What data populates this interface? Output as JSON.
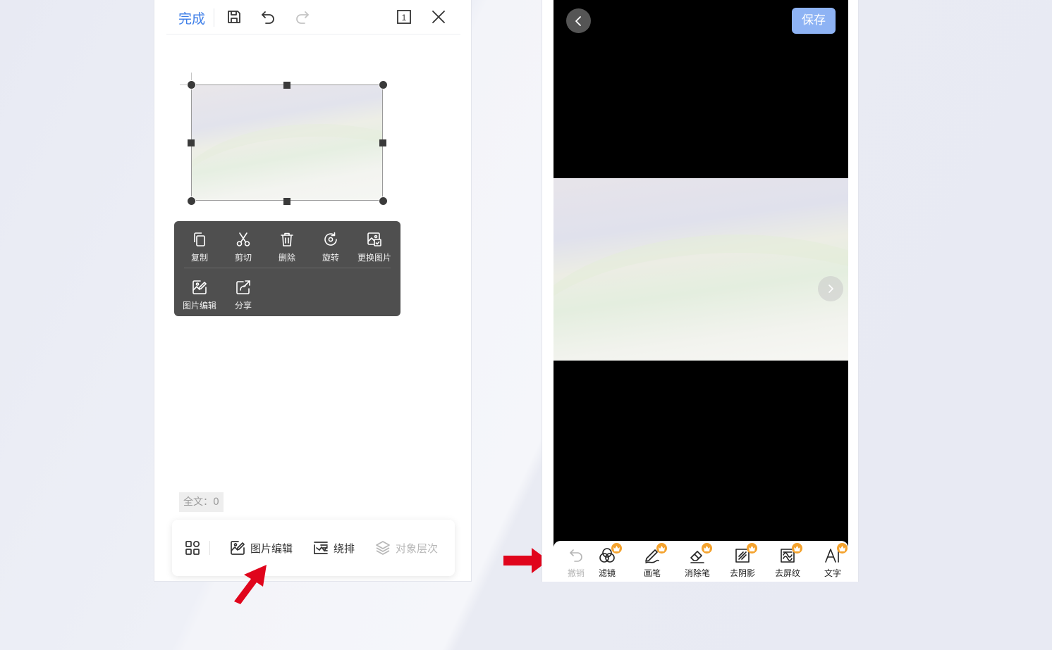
{
  "left_phone": {
    "toolbar": {
      "done_label": "完成",
      "page_indicator": "1"
    },
    "context_menu": {
      "items": [
        {
          "label": "复制",
          "icon": "copy-icon"
        },
        {
          "label": "剪切",
          "icon": "scissors-icon"
        },
        {
          "label": "删除",
          "icon": "trash-icon"
        },
        {
          "label": "旋转",
          "icon": "rotate-icon"
        },
        {
          "label": "更换图片",
          "icon": "replace-image-icon"
        },
        {
          "label": "图片编辑",
          "icon": "image-edit-icon"
        },
        {
          "label": "分享",
          "icon": "share-icon"
        }
      ]
    },
    "word_count": "全文：0",
    "bottom_bar": {
      "image_edit_label": "图片编辑",
      "wrap_label": "绕排",
      "layer_label": "对象层次"
    }
  },
  "right_phone": {
    "save_label": "保存",
    "tools": [
      {
        "label": "撤销",
        "icon": "undo-icon",
        "vip": false,
        "enabled": false
      },
      {
        "label": "滤镜",
        "icon": "filter-icon",
        "vip": true,
        "enabled": true
      },
      {
        "label": "画笔",
        "icon": "pen-icon",
        "vip": true,
        "enabled": true
      },
      {
        "label": "消除笔",
        "icon": "eraser-icon",
        "vip": true,
        "enabled": true
      },
      {
        "label": "去阴影",
        "icon": "remove-shadow-icon",
        "vip": true,
        "enabled": true
      },
      {
        "label": "去屏纹",
        "icon": "remove-moire-icon",
        "vip": true,
        "enabled": true
      },
      {
        "label": "文字",
        "icon": "ai-text-icon",
        "vip": true,
        "enabled": true
      }
    ]
  },
  "colors": {
    "accent_blue": "#3d7ee8",
    "save_button": "#8eb3f4",
    "vip_badge": "#f4a22d",
    "arrow_red": "#e0051c",
    "menu_bg": "#4f4f4f"
  }
}
